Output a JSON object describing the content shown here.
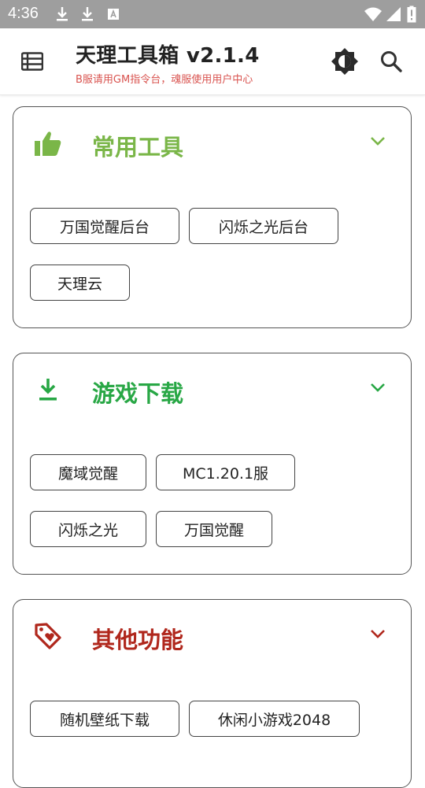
{
  "status_bar": {
    "time": "4:36"
  },
  "app_bar": {
    "title": "天理工具箱 v2.1.4",
    "subtitle": "B服请用GM指令台，魂服使用用户中心"
  },
  "colors": {
    "common": "#7ab648",
    "download": "#28a745",
    "other": "#b0271c",
    "subtitle": "#d9534f"
  },
  "sections": [
    {
      "title": "常用工具",
      "icon": "thumbs-up-icon",
      "buttons": [
        "万国觉醒后台",
        "闪烁之光后台",
        "天理云"
      ]
    },
    {
      "title": "游戏下载",
      "icon": "download-icon",
      "buttons": [
        "魔域觉醒",
        "MC1.20.1服",
        "闪烁之光",
        "万国觉醒"
      ]
    },
    {
      "title": "其他功能",
      "icon": "tag-heart-icon",
      "buttons": [
        "随机壁纸下载",
        "休闲小游戏2048"
      ]
    }
  ]
}
